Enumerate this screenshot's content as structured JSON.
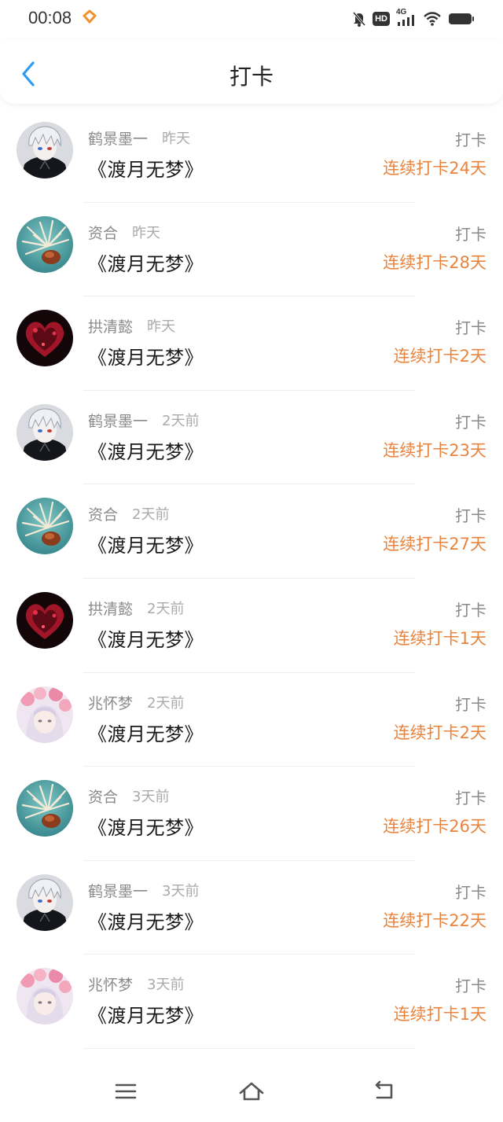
{
  "status_bar": {
    "time": "00:08",
    "network": "4G",
    "hd": "HD",
    "icons": [
      "app-heart-icon",
      "mute-bell-icon",
      "hd-icon",
      "4g-signal-icon",
      "wifi-icon",
      "battery-icon"
    ]
  },
  "header": {
    "title": "打卡",
    "back_icon": "chevron-left-icon"
  },
  "colors": {
    "accent_blue": "#2f9bf0",
    "streak_orange": "#e8843e",
    "muted_text": "#8a8a8a"
  },
  "records": [
    {
      "user": "鹤景墨一",
      "time": "昨天",
      "book": "《渡月无梦》",
      "action": "打卡",
      "streak": "连续打卡24天",
      "avatar": "avatar-anime-boy"
    },
    {
      "user": "资合",
      "time": "昨天",
      "book": "《渡月无梦》",
      "action": "打卡",
      "streak": "连续打卡28天",
      "avatar": "avatar-flower"
    },
    {
      "user": "拱清懿",
      "time": "昨天",
      "book": "《渡月无梦》",
      "action": "打卡",
      "streak": "连续打卡2天",
      "avatar": "avatar-red-heart"
    },
    {
      "user": "鹤景墨一",
      "time": "2天前",
      "book": "《渡月无梦》",
      "action": "打卡",
      "streak": "连续打卡23天",
      "avatar": "avatar-anime-boy"
    },
    {
      "user": "资合",
      "time": "2天前",
      "book": "《渡月无梦》",
      "action": "打卡",
      "streak": "连续打卡27天",
      "avatar": "avatar-flower"
    },
    {
      "user": "拱清懿",
      "time": "2天前",
      "book": "《渡月无梦》",
      "action": "打卡",
      "streak": "连续打卡1天",
      "avatar": "avatar-red-heart"
    },
    {
      "user": "兆怀梦",
      "time": "2天前",
      "book": "《渡月无梦》",
      "action": "打卡",
      "streak": "连续打卡2天",
      "avatar": "avatar-pink-girl"
    },
    {
      "user": "资合",
      "time": "3天前",
      "book": "《渡月无梦》",
      "action": "打卡",
      "streak": "连续打卡26天",
      "avatar": "avatar-flower"
    },
    {
      "user": "鹤景墨一",
      "time": "3天前",
      "book": "《渡月无梦》",
      "action": "打卡",
      "streak": "连续打卡22天",
      "avatar": "avatar-anime-boy"
    },
    {
      "user": "兆怀梦",
      "time": "3天前",
      "book": "《渡月无梦》",
      "action": "打卡",
      "streak": "连续打卡1天",
      "avatar": "avatar-pink-girl"
    }
  ],
  "nav_bar": {
    "icons": [
      "menu-icon",
      "home-icon",
      "back-return-icon"
    ]
  }
}
